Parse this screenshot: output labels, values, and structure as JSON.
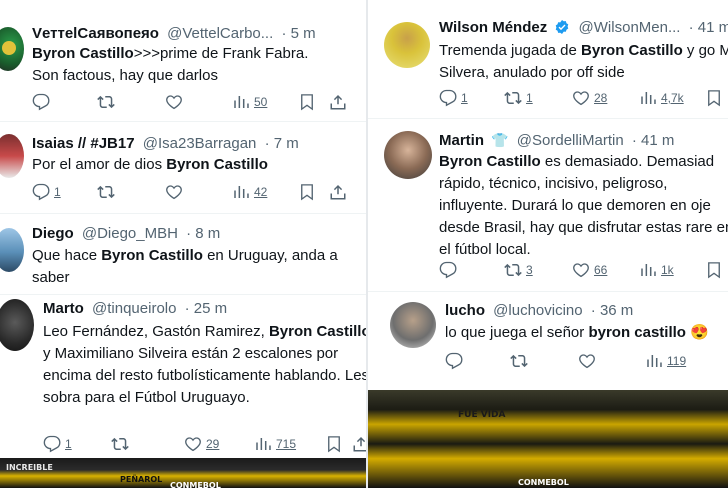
{
  "left_column": {
    "tweets": [
      {
        "name": "VеттеlСаявопеяо",
        "handle": "@VettelCarbo...",
        "time": "· 5 m",
        "body": [
          {
            "b": "Byron Castillo"
          },
          ">>>prime de Frank Fabra. Son factous, hay que darlos"
        ],
        "stats": {
          "replies": "",
          "retweets": "",
          "likes": "",
          "views": "50"
        }
      },
      {
        "name": "Isaias // #JB17",
        "handle": "@Isa23Barragan",
        "time": "· 7 m",
        "body": [
          "Por el amor de dios ",
          {
            "b": "Byron Castillo"
          }
        ],
        "stats": {
          "replies": "1",
          "retweets": "",
          "likes": "",
          "views": "42"
        }
      },
      {
        "name": "Diego",
        "handle": "@Diego_MBH",
        "time": "· 8 m",
        "body": [
          "Que hace ",
          {
            "b": "Byron Castillo"
          },
          " en Uruguay, anda a saber"
        ],
        "stats": null
      },
      {
        "name": "Marto",
        "handle": "@tinqueirolo",
        "time": "· 25 m",
        "body": [
          "Leo Fernández, Gastón Ramirez, ",
          {
            "b": "Byron Castillo"
          },
          " y Maximiliano Silveira están 2 escalones por encima del resto futbolísticamente hablando. Les sobra para el Fútbol Uruguayo."
        ],
        "stats": {
          "replies": "1",
          "retweets": "",
          "likes": "29",
          "views": "715"
        }
      }
    ]
  },
  "right_column": {
    "tweets": [
      {
        "name": "Wilson Méndez",
        "handle": "@WilsonMen...",
        "time": "· 41 m",
        "verified": true,
        "body": [
          "Tremenda jugada de ",
          {
            "b": "Byron Castillo"
          },
          " y go Maxi Silvera, anulado por off side"
        ],
        "stats": {
          "replies": "1",
          "retweets": "1",
          "likes": "28",
          "views": "4,7k"
        }
      },
      {
        "name": "Martin",
        "handle": "@SordelliMartin",
        "time": "· 41 m",
        "shirt": true,
        "body": [
          {
            "b": "Byron Castillo"
          },
          " es demasiado. Demasiad rápido, técnico, incisivo, peligroso, influyente. Durará lo que demoren en oje desde Brasil, hay que disfrutar estas rare en el fútbol local."
        ],
        "stats": {
          "replies": "",
          "retweets": "3",
          "likes": "66",
          "views": "1k"
        }
      },
      {
        "name": "lucho",
        "handle": "@luchovicino",
        "time": "· 36 m",
        "body": [
          "lo que juega el señor ",
          {
            "b": "byron castillo"
          },
          " 😍"
        ],
        "stats": {
          "replies": "",
          "retweets": "",
          "likes": "",
          "views": "119"
        }
      }
    ]
  },
  "stadium": {
    "banners": [
      "INCREIBLE",
      "PEÑAROL",
      "CONMEBOL",
      "FUE VIDA"
    ]
  },
  "colors": {
    "accent": "#1d9bf0",
    "muted": "#536471",
    "text": "#0f1419",
    "border": "#eff3f4"
  }
}
